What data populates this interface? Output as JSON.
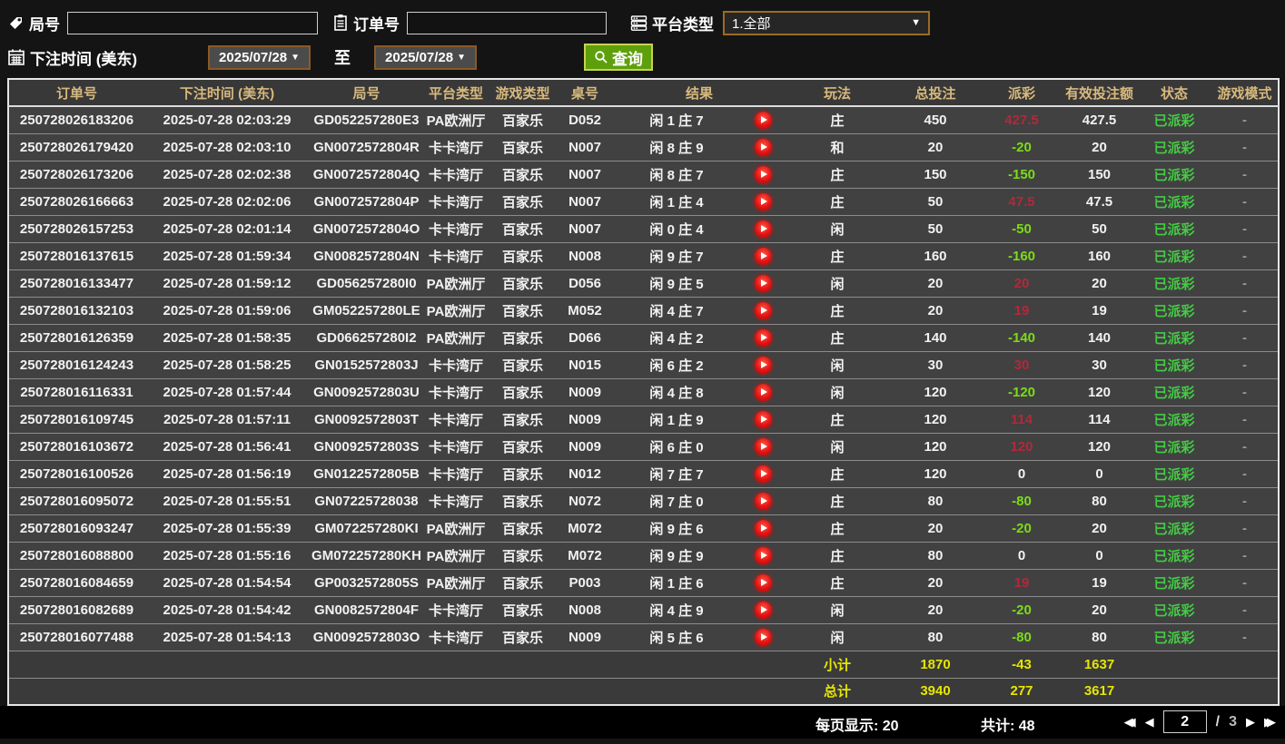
{
  "filters": {
    "game_no_label": "局号",
    "order_no_label": "订单号",
    "platform_label": "平台类型",
    "platform_value": "1.全部",
    "bet_time_label": "下注时间 (美东)",
    "date_from": "2025/07/28",
    "date_to": "2025/07/28",
    "to_label": "至",
    "query_label": "查询",
    "dropdown_arrow": "▼"
  },
  "table": {
    "headers": {
      "order_id": "订单号",
      "bet_time": "下注时间 (美东)",
      "game_no": "局号",
      "platform": "平台类型",
      "game_type": "游戏类型",
      "table_no": "桌号",
      "result": "结果",
      "play": "玩法",
      "total_bet": "总投注",
      "payout": "派彩",
      "valid_bet": "有效投注额",
      "status": "状态",
      "mode": "游戏模式"
    },
    "rows": [
      {
        "order_id": "250728026183206",
        "bet_time": "2025-07-28 02:03:29",
        "game_no": "GD052257280E3",
        "platform": "PA欧洲厅",
        "game_type": "百家乐",
        "table_no": "D052",
        "result": "闲 1 庄 7",
        "play": "庄",
        "total_bet": "450",
        "payout": "427.5",
        "payout_color": "red",
        "valid_bet": "427.5",
        "status": "已派彩",
        "mode": "-"
      },
      {
        "order_id": "250728026179420",
        "bet_time": "2025-07-28 02:03:10",
        "game_no": "GN0072572804R",
        "platform": "卡卡湾厅",
        "game_type": "百家乐",
        "table_no": "N007",
        "result": "闲 8 庄 9",
        "play": "和",
        "total_bet": "20",
        "payout": "-20",
        "payout_color": "green",
        "valid_bet": "20",
        "status": "已派彩",
        "mode": "-"
      },
      {
        "order_id": "250728026173206",
        "bet_time": "2025-07-28 02:02:38",
        "game_no": "GN0072572804Q",
        "platform": "卡卡湾厅",
        "game_type": "百家乐",
        "table_no": "N007",
        "result": "闲 8 庄 7",
        "play": "庄",
        "total_bet": "150",
        "payout": "-150",
        "payout_color": "green",
        "valid_bet": "150",
        "status": "已派彩",
        "mode": "-"
      },
      {
        "order_id": "250728026166663",
        "bet_time": "2025-07-28 02:02:06",
        "game_no": "GN0072572804P",
        "platform": "卡卡湾厅",
        "game_type": "百家乐",
        "table_no": "N007",
        "result": "闲 1 庄 4",
        "play": "庄",
        "total_bet": "50",
        "payout": "47.5",
        "payout_color": "red",
        "valid_bet": "47.5",
        "status": "已派彩",
        "mode": "-"
      },
      {
        "order_id": "250728026157253",
        "bet_time": "2025-07-28 02:01:14",
        "game_no": "GN0072572804O",
        "platform": "卡卡湾厅",
        "game_type": "百家乐",
        "table_no": "N007",
        "result": "闲 0 庄 4",
        "play": "闲",
        "total_bet": "50",
        "payout": "-50",
        "payout_color": "green",
        "valid_bet": "50",
        "status": "已派彩",
        "mode": "-"
      },
      {
        "order_id": "250728016137615",
        "bet_time": "2025-07-28 01:59:34",
        "game_no": "GN0082572804N",
        "platform": "卡卡湾厅",
        "game_type": "百家乐",
        "table_no": "N008",
        "result": "闲 9 庄 7",
        "play": "庄",
        "total_bet": "160",
        "payout": "-160",
        "payout_color": "green",
        "valid_bet": "160",
        "status": "已派彩",
        "mode": "-"
      },
      {
        "order_id": "250728016133477",
        "bet_time": "2025-07-28 01:59:12",
        "game_no": "GD056257280I0",
        "platform": "PA欧洲厅",
        "game_type": "百家乐",
        "table_no": "D056",
        "result": "闲 9 庄 5",
        "play": "闲",
        "total_bet": "20",
        "payout": "20",
        "payout_color": "red",
        "valid_bet": "20",
        "status": "已派彩",
        "mode": "-"
      },
      {
        "order_id": "250728016132103",
        "bet_time": "2025-07-28 01:59:06",
        "game_no": "GM052257280LE",
        "platform": "PA欧洲厅",
        "game_type": "百家乐",
        "table_no": "M052",
        "result": "闲 4 庄 7",
        "play": "庄",
        "total_bet": "20",
        "payout": "19",
        "payout_color": "red",
        "valid_bet": "19",
        "status": "已派彩",
        "mode": "-"
      },
      {
        "order_id": "250728016126359",
        "bet_time": "2025-07-28 01:58:35",
        "game_no": "GD066257280I2",
        "platform": "PA欧洲厅",
        "game_type": "百家乐",
        "table_no": "D066",
        "result": "闲 4 庄 2",
        "play": "庄",
        "total_bet": "140",
        "payout": "-140",
        "payout_color": "green",
        "valid_bet": "140",
        "status": "已派彩",
        "mode": "-"
      },
      {
        "order_id": "250728016124243",
        "bet_time": "2025-07-28 01:58:25",
        "game_no": "GN0152572803J",
        "platform": "卡卡湾厅",
        "game_type": "百家乐",
        "table_no": "N015",
        "result": "闲 6 庄 2",
        "play": "闲",
        "total_bet": "30",
        "payout": "30",
        "payout_color": "red",
        "valid_bet": "30",
        "status": "已派彩",
        "mode": "-"
      },
      {
        "order_id": "250728016116331",
        "bet_time": "2025-07-28 01:57:44",
        "game_no": "GN0092572803U",
        "platform": "卡卡湾厅",
        "game_type": "百家乐",
        "table_no": "N009",
        "result": "闲 4 庄 8",
        "play": "闲",
        "total_bet": "120",
        "payout": "-120",
        "payout_color": "green",
        "valid_bet": "120",
        "status": "已派彩",
        "mode": "-"
      },
      {
        "order_id": "250728016109745",
        "bet_time": "2025-07-28 01:57:11",
        "game_no": "GN0092572803T",
        "platform": "卡卡湾厅",
        "game_type": "百家乐",
        "table_no": "N009",
        "result": "闲 1 庄 9",
        "play": "庄",
        "total_bet": "120",
        "payout": "114",
        "payout_color": "red",
        "valid_bet": "114",
        "status": "已派彩",
        "mode": "-"
      },
      {
        "order_id": "250728016103672",
        "bet_time": "2025-07-28 01:56:41",
        "game_no": "GN0092572803S",
        "platform": "卡卡湾厅",
        "game_type": "百家乐",
        "table_no": "N009",
        "result": "闲 6 庄 0",
        "play": "闲",
        "total_bet": "120",
        "payout": "120",
        "payout_color": "red",
        "valid_bet": "120",
        "status": "已派彩",
        "mode": "-"
      },
      {
        "order_id": "250728016100526",
        "bet_time": "2025-07-28 01:56:19",
        "game_no": "GN0122572805B",
        "platform": "卡卡湾厅",
        "game_type": "百家乐",
        "table_no": "N012",
        "result": "闲 7 庄 7",
        "play": "庄",
        "total_bet": "120",
        "payout": "0",
        "payout_color": "white",
        "valid_bet": "0",
        "status": "已派彩",
        "mode": "-"
      },
      {
        "order_id": "250728016095072",
        "bet_time": "2025-07-28 01:55:51",
        "game_no": "GN07225728038",
        "platform": "卡卡湾厅",
        "game_type": "百家乐",
        "table_no": "N072",
        "result": "闲 7 庄 0",
        "play": "庄",
        "total_bet": "80",
        "payout": "-80",
        "payout_color": "green",
        "valid_bet": "80",
        "status": "已派彩",
        "mode": "-"
      },
      {
        "order_id": "250728016093247",
        "bet_time": "2025-07-28 01:55:39",
        "game_no": "GM072257280KI",
        "platform": "PA欧洲厅",
        "game_type": "百家乐",
        "table_no": "M072",
        "result": "闲 9 庄 6",
        "play": "庄",
        "total_bet": "20",
        "payout": "-20",
        "payout_color": "green",
        "valid_bet": "20",
        "status": "已派彩",
        "mode": "-"
      },
      {
        "order_id": "250728016088800",
        "bet_time": "2025-07-28 01:55:16",
        "game_no": "GM072257280KH",
        "platform": "PA欧洲厅",
        "game_type": "百家乐",
        "table_no": "M072",
        "result": "闲 9 庄 9",
        "play": "庄",
        "total_bet": "80",
        "payout": "0",
        "payout_color": "white",
        "valid_bet": "0",
        "status": "已派彩",
        "mode": "-"
      },
      {
        "order_id": "250728016084659",
        "bet_time": "2025-07-28 01:54:54",
        "game_no": "GP0032572805S",
        "platform": "PA欧洲厅",
        "game_type": "百家乐",
        "table_no": "P003",
        "result": "闲 1 庄 6",
        "play": "庄",
        "total_bet": "20",
        "payout": "19",
        "payout_color": "red",
        "valid_bet": "19",
        "status": "已派彩",
        "mode": "-"
      },
      {
        "order_id": "250728016082689",
        "bet_time": "2025-07-28 01:54:42",
        "game_no": "GN0082572804F",
        "platform": "卡卡湾厅",
        "game_type": "百家乐",
        "table_no": "N008",
        "result": "闲 4 庄 9",
        "play": "闲",
        "total_bet": "20",
        "payout": "-20",
        "payout_color": "green",
        "valid_bet": "20",
        "status": "已派彩",
        "mode": "-"
      },
      {
        "order_id": "250728016077488",
        "bet_time": "2025-07-28 01:54:13",
        "game_no": "GN0092572803O",
        "platform": "卡卡湾厅",
        "game_type": "百家乐",
        "table_no": "N009",
        "result": "闲 5 庄 6",
        "play": "闲",
        "total_bet": "80",
        "payout": "-80",
        "payout_color": "green",
        "valid_bet": "80",
        "status": "已派彩",
        "mode": "-"
      }
    ],
    "subtotal": {
      "label": "小计",
      "total_bet": "1870",
      "payout": "-43",
      "valid_bet": "1637"
    },
    "total": {
      "label": "总计",
      "total_bet": "3940",
      "payout": "277",
      "valid_bet": "3617"
    }
  },
  "pagination": {
    "per_page_text": "每页显示: 20",
    "total_text": "共计: 48",
    "current_page": "2",
    "page_separator": "/",
    "total_pages": "3",
    "first_icon": "◀◀",
    "prev_icon": "◀",
    "next_icon": "▶",
    "last_icon": "▶▶"
  },
  "colors": {
    "payout_win": "#b3283a",
    "payout_loss": "#7bdc16",
    "status_paid": "#44cb44",
    "totals": "#e6e600",
    "header_text": "#d8b97e",
    "query_button": "#5ea00c",
    "date_border": "#8a5a24"
  }
}
